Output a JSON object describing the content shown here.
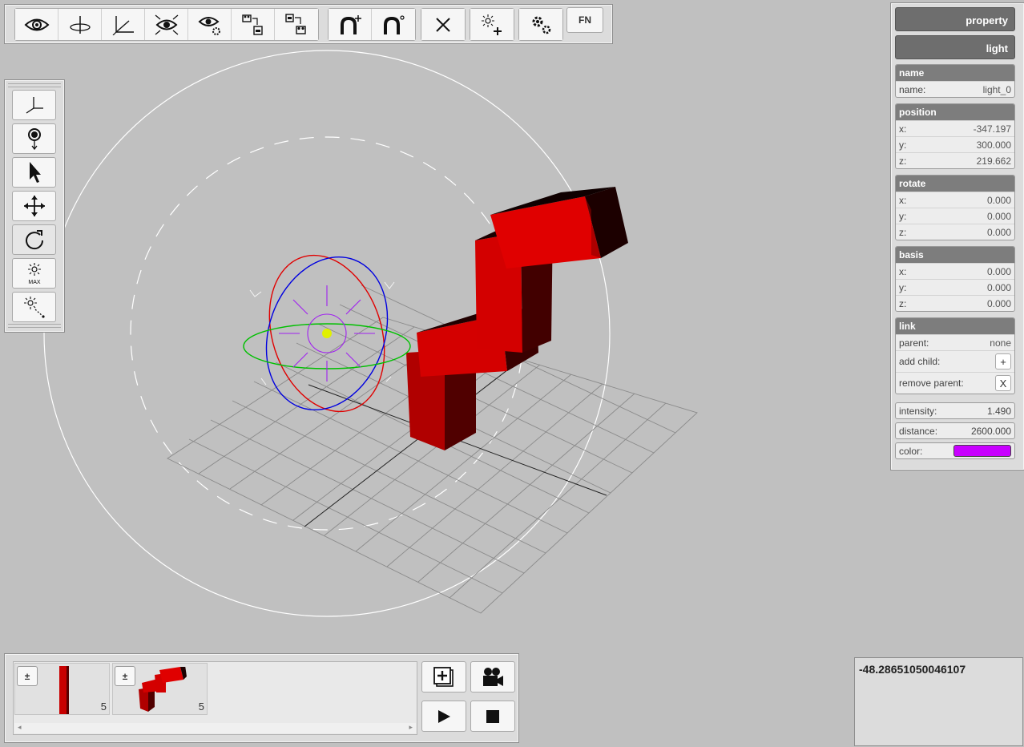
{
  "toolbar": {
    "groups": [
      {
        "buttons": [
          "eye-icon",
          "rotate-view-icon",
          "axes-angle-icon",
          "eye-focus-icon",
          "eye-settings-icon",
          "camera-import-icon",
          "camera-export-icon"
        ]
      },
      {
        "buttons": [
          "magnet-plus-icon",
          "magnet-icon"
        ]
      },
      {
        "buttons": [
          "close-icon"
        ]
      },
      {
        "buttons": [
          "add-light-icon"
        ]
      },
      {
        "buttons": [
          "settings-gears-icon"
        ]
      }
    ],
    "fn_label": "FN"
  },
  "left_tools": {
    "items": [
      "axes-icon",
      "pin-down-icon",
      "pointer-icon",
      "move-icon",
      "rotate-icon",
      "light-max-icon",
      "light-wand-icon"
    ],
    "active": "rotate-icon"
  },
  "property": {
    "header": "property",
    "subheader": "light",
    "name": {
      "title": "name",
      "label": "name:",
      "value": "light_0"
    },
    "position": {
      "title": "position",
      "x_label": "x:",
      "x": "-347.197",
      "y_label": "y:",
      "y": "300.000",
      "z_label": "z:",
      "z": "219.662"
    },
    "rotate": {
      "title": "rotate",
      "x_label": "x:",
      "x": "0.000",
      "y_label": "y:",
      "y": "0.000",
      "z_label": "z:",
      "z": "0.000"
    },
    "basis": {
      "title": "basis",
      "x_label": "x:",
      "x": "0.000",
      "y_label": "y:",
      "y": "0.000",
      "z_label": "z:",
      "z": "0.000"
    },
    "link": {
      "title": "link",
      "parent_label": "parent:",
      "parent": "none",
      "add_child_label": "add child:",
      "add_child_btn": "+",
      "remove_parent_label": "remove parent:",
      "remove_parent_btn": "X"
    },
    "intensity_label": "intensity:",
    "intensity": "1.490",
    "distance_label": "distance:",
    "distance": "2600.000",
    "color_label": "color:",
    "color": "#c800ff"
  },
  "timeline": {
    "frames": [
      {
        "expand": "±",
        "count": "5",
        "thumb": "red-bar-thumbnail"
      },
      {
        "expand": "±",
        "count": "5",
        "thumb": "red-shape-thumbnail"
      }
    ],
    "scroll_left": "◂",
    "scroll_right": "▸"
  },
  "controls": [
    "add-frame-icon",
    "camera-icon",
    "play-icon",
    "stop-icon"
  ],
  "readout": "-48.28651050046107",
  "colors": {
    "object": "#d80000",
    "gizmo_x": "#e00000",
    "gizmo_y": "#0000e0",
    "gizmo_z": "#00c000",
    "light_center": "#e0f000"
  }
}
